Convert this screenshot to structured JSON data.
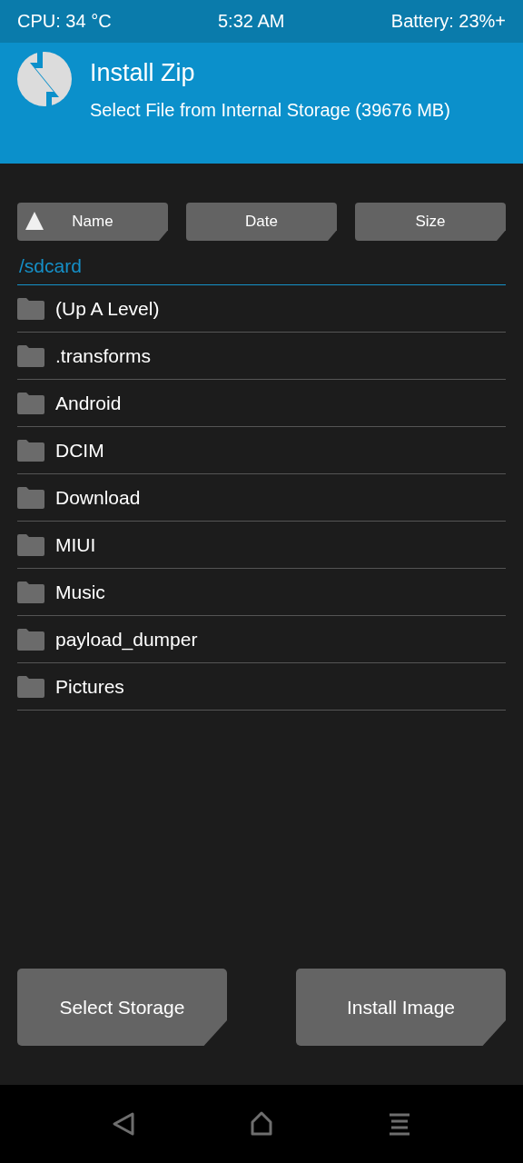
{
  "status_bar": {
    "cpu": "CPU: 34 °C",
    "time": "5:32 AM",
    "battery": "Battery: 23%+"
  },
  "header": {
    "title": "Install Zip",
    "subtitle": "Select File from Internal Storage (39676 MB)"
  },
  "sort_buttons": [
    {
      "label": "Name",
      "selected": true
    },
    {
      "label": "Date",
      "selected": false
    },
    {
      "label": "Size",
      "selected": false
    }
  ],
  "path": "/sdcard",
  "files": [
    {
      "name": "(Up A Level)",
      "kind": "folder"
    },
    {
      "name": ".transforms",
      "kind": "folder"
    },
    {
      "name": "Android",
      "kind": "folder"
    },
    {
      "name": "DCIM",
      "kind": "folder"
    },
    {
      "name": "Download",
      "kind": "folder"
    },
    {
      "name": "MIUI",
      "kind": "folder"
    },
    {
      "name": "Music",
      "kind": "folder"
    },
    {
      "name": "payload_dumper",
      "kind": "folder"
    },
    {
      "name": "Pictures",
      "kind": "folder"
    }
  ],
  "buttons": [
    "Select Storage",
    "Install Image"
  ]
}
